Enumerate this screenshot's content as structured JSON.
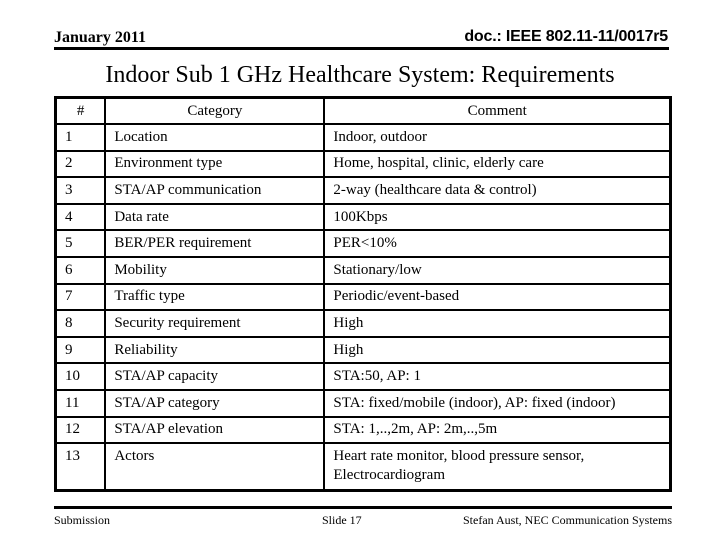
{
  "header": {
    "date": "January 2011",
    "doc_id": "doc.: IEEE 802.11-11/0017r5"
  },
  "title": "Indoor Sub 1 GHz Healthcare System: Requirements",
  "table": {
    "columns": [
      "#",
      "Category",
      "Comment"
    ],
    "rows": [
      {
        "num": "1",
        "category": "Location",
        "comment": "Indoor, outdoor"
      },
      {
        "num": "2",
        "category": "Environment type",
        "comment": "Home, hospital, clinic, elderly care"
      },
      {
        "num": "3",
        "category": "STA/AP communication",
        "comment": "2-way (healthcare data & control)"
      },
      {
        "num": "4",
        "category": "Data rate",
        "comment": "100Kbps"
      },
      {
        "num": "5",
        "category": "BER/PER requirement",
        "comment": "PER<10%"
      },
      {
        "num": "6",
        "category": "Mobility",
        "comment": "Stationary/low"
      },
      {
        "num": "7",
        "category": "Traffic type",
        "comment": "Periodic/event-based"
      },
      {
        "num": "8",
        "category": "Security requirement",
        "comment": "High"
      },
      {
        "num": "9",
        "category": "Reliability",
        "comment": "High"
      },
      {
        "num": "10",
        "category": "STA/AP capacity",
        "comment": "STA:50, AP: 1"
      },
      {
        "num": "11",
        "category": "STA/AP category",
        "comment": "STA: fixed/mobile (indoor), AP: fixed (indoor)"
      },
      {
        "num": "12",
        "category": "STA/AP elevation",
        "comment": "STA: 1,..,2m, AP: 2m,..,5m"
      },
      {
        "num": "13",
        "category": "Actors",
        "comment_lines": [
          "Heart rate monitor, blood pressure sensor,",
          "Electrocardiogram"
        ]
      }
    ]
  },
  "footer": {
    "left": "Submission",
    "center": "Slide 17",
    "right": "Stefan Aust, NEC Communication Systems"
  }
}
